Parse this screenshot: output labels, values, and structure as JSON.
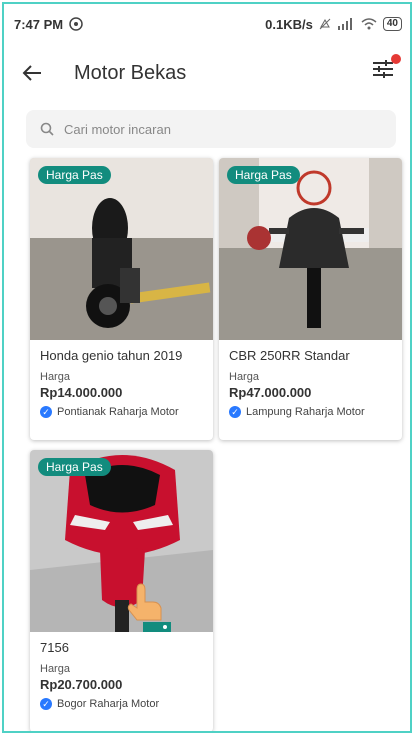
{
  "status_bar": {
    "time": "7:47 PM",
    "speed": "0.1KB/s",
    "battery": "40"
  },
  "appbar": {
    "title": "Motor Bekas"
  },
  "search": {
    "placeholder": "Cari motor incaran"
  },
  "listings": [
    {
      "badge": "Harga Pas",
      "name": "Honda genio tahun 2019",
      "price_label": "Harga",
      "price": "Rp14.000.000",
      "seller": "Pontianak Raharja Motor"
    },
    {
      "badge": "Harga Pas",
      "name": "CBR 250RR Standar",
      "price_label": "Harga",
      "price": "Rp47.000.000",
      "seller": "Lampung Raharja Motor"
    },
    {
      "badge": "Harga Pas",
      "name": "7156",
      "price_label": "Harga",
      "price": "Rp20.700.000",
      "seller": "Bogor Raharja Motor"
    }
  ],
  "colors": {
    "accent": "#128c7e",
    "verified": "#2979ff",
    "notification": "#e53935"
  }
}
